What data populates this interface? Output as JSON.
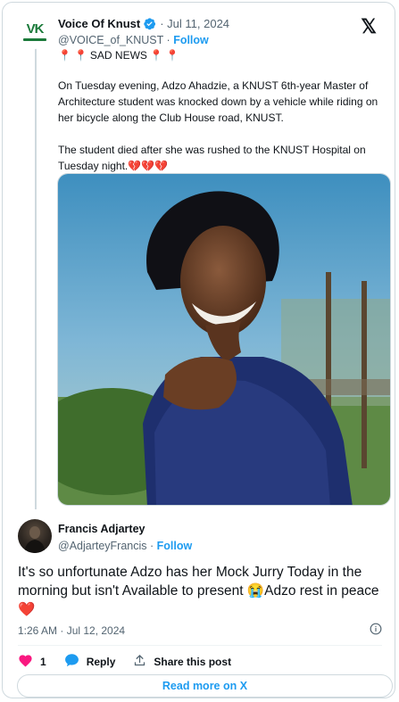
{
  "tweet": {
    "author_name": "Voice Of Knust",
    "handle": "@VOICE_of_KNUST",
    "date": "· Jul 11, 2024",
    "follow_label": "Follow",
    "sad_news": "SAD NEWS",
    "paragraph1": "On Tuesday evening, Adzo Ahadzie, a KNUST 6th-year Master of Architecture student was knocked down by a vehicle while riding on her bicycle along the Club House road, KNUST.",
    "paragraph2": "The student died after she was rushed to the KNUST Hospital on Tuesday night.",
    "emoji_hearts": "💔💔💔",
    "avatar_logo_text": "VK"
  },
  "reply": {
    "author_name": "Francis Adjartey",
    "handle": "@AdjarteyFrancis",
    "follow_label": "Follow",
    "text": "It's so unfortunate Adzo has her Mock Jurry Today in the morning but isn't Available to present 😭Adzo rest in peace ❤️",
    "timestamp": "1:26 AM · Jul 12, 2024"
  },
  "actions": {
    "like_count": "1",
    "reply_label": "Reply",
    "share_label": "Share this post"
  },
  "read_more_label": "Read more on X",
  "colors": {
    "accent": "#1d9bf0",
    "text": "#0f1419",
    "muted": "#536471",
    "like": "#f91880"
  },
  "icons": [
    "verified-badge-icon",
    "x-logo-icon",
    "pin-icon",
    "info-icon",
    "heart-icon",
    "reply-bubble-icon",
    "share-icon"
  ]
}
